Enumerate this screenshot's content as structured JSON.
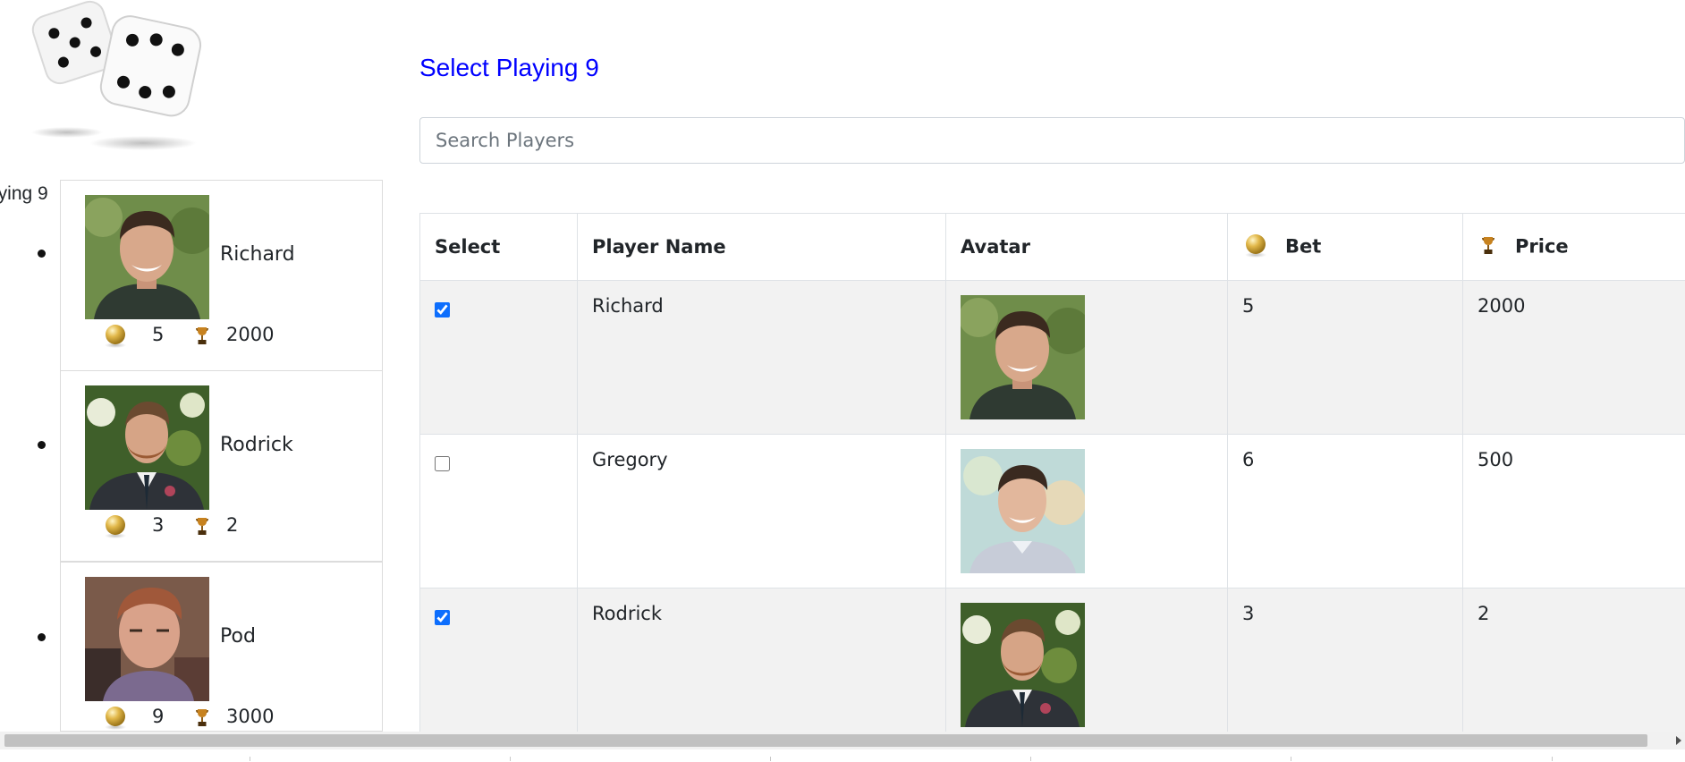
{
  "sidebar": {
    "label": "aying 9",
    "players": [
      {
        "name": "Richard",
        "bet": "5",
        "price": "2000",
        "avatar": "avatar-richard"
      },
      {
        "name": "Rodrick",
        "bet": "3",
        "price": "2",
        "avatar": "avatar-rodrick"
      },
      {
        "name": "Pod",
        "bet": "9",
        "price": "3000",
        "avatar": "avatar-pod"
      }
    ]
  },
  "main": {
    "title": "Select Playing 9",
    "search": {
      "placeholder": "Search Players",
      "value": ""
    },
    "table": {
      "headers": {
        "select": "Select",
        "player_name": "Player Name",
        "avatar": "Avatar",
        "bet": "Bet",
        "price": "Price"
      },
      "rows": [
        {
          "selected": true,
          "name": "Richard",
          "bet": "5",
          "price": "2000",
          "avatar": "avatar-richard"
        },
        {
          "selected": false,
          "name": "Gregory",
          "bet": "6",
          "price": "500",
          "avatar": "avatar-gregory"
        },
        {
          "selected": true,
          "name": "Rodrick",
          "bet": "3",
          "price": "2",
          "avatar": "avatar-rodrick"
        }
      ]
    }
  },
  "icons": {
    "logo": "dice-icon",
    "bet": "gold-coin-icon",
    "price": "trophy-icon",
    "scroll_right": "scroll-right-arrow-icon"
  },
  "colors": {
    "title": "#0000ff",
    "checkbox": "#0d6efd",
    "striped_row": "#f2f2f2",
    "coin": "#d4a93c",
    "trophy": "#8a5a16"
  }
}
